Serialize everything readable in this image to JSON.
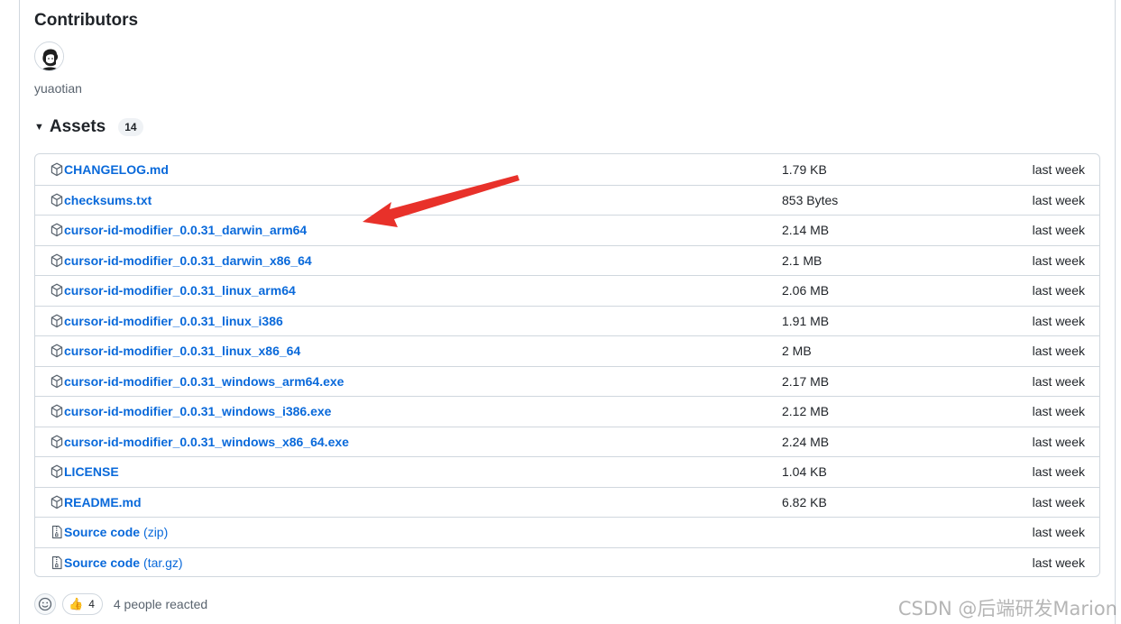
{
  "contributors": {
    "title": "Contributors",
    "name": "yuaotian"
  },
  "assets": {
    "title": "Assets",
    "count": "14",
    "items": [
      {
        "name": "CHANGELOG.md",
        "suffix": "",
        "size": "1.79 KB",
        "date": "last week",
        "icon": "package-icon"
      },
      {
        "name": "checksums.txt",
        "suffix": "",
        "size": "853 Bytes",
        "date": "last week",
        "icon": "package-icon"
      },
      {
        "name": "cursor-id-modifier_0.0.31_darwin_arm64",
        "suffix": "",
        "size": "2.14 MB",
        "date": "last week",
        "icon": "package-icon"
      },
      {
        "name": "cursor-id-modifier_0.0.31_darwin_x86_64",
        "suffix": "",
        "size": "2.1 MB",
        "date": "last week",
        "icon": "package-icon"
      },
      {
        "name": "cursor-id-modifier_0.0.31_linux_arm64",
        "suffix": "",
        "size": "2.06 MB",
        "date": "last week",
        "icon": "package-icon"
      },
      {
        "name": "cursor-id-modifier_0.0.31_linux_i386",
        "suffix": "",
        "size": "1.91 MB",
        "date": "last week",
        "icon": "package-icon"
      },
      {
        "name": "cursor-id-modifier_0.0.31_linux_x86_64",
        "suffix": "",
        "size": "2 MB",
        "date": "last week",
        "icon": "package-icon"
      },
      {
        "name": "cursor-id-modifier_0.0.31_windows_arm64.exe",
        "suffix": "",
        "size": "2.17 MB",
        "date": "last week",
        "icon": "package-icon"
      },
      {
        "name": "cursor-id-modifier_0.0.31_windows_i386.exe",
        "suffix": "",
        "size": "2.12 MB",
        "date": "last week",
        "icon": "package-icon"
      },
      {
        "name": "cursor-id-modifier_0.0.31_windows_x86_64.exe",
        "suffix": "",
        "size": "2.24 MB",
        "date": "last week",
        "icon": "package-icon"
      },
      {
        "name": "LICENSE",
        "suffix": "",
        "size": "1.04 KB",
        "date": "last week",
        "icon": "package-icon"
      },
      {
        "name": "README.md",
        "suffix": "",
        "size": "6.82 KB",
        "date": "last week",
        "icon": "package-icon"
      },
      {
        "name": "Source code",
        "suffix": "(zip)",
        "size": "",
        "date": "last week",
        "icon": "file-zip-icon"
      },
      {
        "name": "Source code",
        "suffix": "(tar.gz)",
        "size": "",
        "date": "last week",
        "icon": "file-zip-icon"
      }
    ]
  },
  "reactions": {
    "thumbs_emoji": "👍",
    "thumbs_count": "4",
    "summary": "4 people reacted"
  },
  "watermark": "CSDN @后端研发Marion",
  "colors": {
    "link": "#0969da",
    "border": "#d0d7de",
    "annotation_arrow": "#e8312a"
  }
}
